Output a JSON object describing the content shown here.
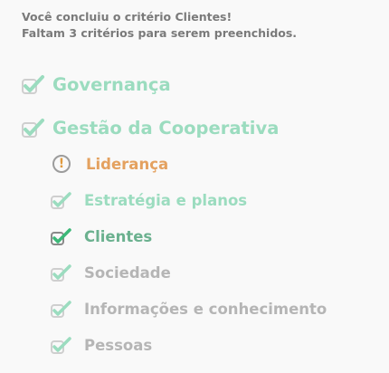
{
  "message": {
    "line1": "Você concluiu o critério Clientes!",
    "line2": "Faltam 3 critérios para serem preenchidos."
  },
  "sections": [
    {
      "label": "Governança",
      "icon": "check-icon",
      "state": "done"
    },
    {
      "label": "Gestão da Cooperativa",
      "icon": "check-icon",
      "state": "done"
    }
  ],
  "criteria": [
    {
      "label": "Liderança",
      "icon": "warning-icon",
      "state": "warning"
    },
    {
      "label": "Estratégia e planos",
      "icon": "check-icon",
      "state": "done"
    },
    {
      "label": "Clientes",
      "icon": "check-icon",
      "state": "current"
    },
    {
      "label": "Sociedade",
      "icon": "check-icon",
      "state": "pending"
    },
    {
      "label": "Informações e conhecimento",
      "icon": "check-icon",
      "state": "pending"
    },
    {
      "label": "Pessoas",
      "icon": "check-icon",
      "state": "pending"
    }
  ],
  "colors": {
    "done": "#9bdcbf",
    "current": "#6bb18f",
    "pending": "#b5b5b5",
    "warning": "#e4a15f"
  }
}
